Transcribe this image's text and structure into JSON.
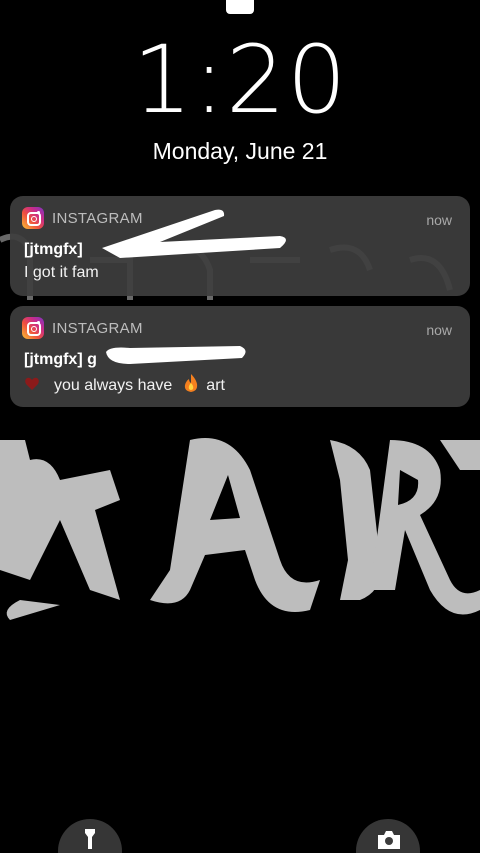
{
  "lock_screen": {
    "time": "1:20",
    "date": "Monday, June 21"
  },
  "notifications": [
    {
      "app_name": "INSTAGRAM",
      "app_icon": "instagram-icon",
      "time": "now",
      "sender": "[jtmgfx]",
      "message": "I got it fam"
    },
    {
      "app_name": "INSTAGRAM",
      "app_icon": "instagram-icon",
      "time": "now",
      "sender": "[jtmgfx] g",
      "message_part1": "you always have",
      "message_part2": "art"
    }
  ],
  "quick_actions": {
    "left_icon": "flashlight-icon",
    "right_icon": "camera-icon"
  },
  "colors": {
    "background": "#000000",
    "notification_bg": "#3e3e3e",
    "instagram_gradient_start": "#f9c235",
    "instagram_gradient_end": "#7a35c4"
  }
}
